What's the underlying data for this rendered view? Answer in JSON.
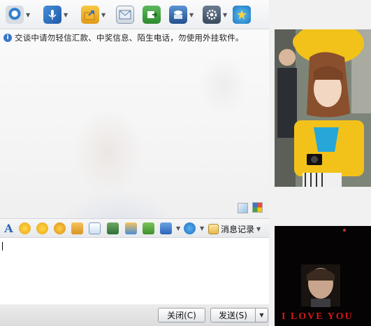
{
  "chat": {
    "warning_text": "交谈中请勿轻信汇款、中奖信息、陌生电话，勿使用外挂软件。"
  },
  "format_bar": {
    "font_icon_text": "A",
    "history_label": "消息记录"
  },
  "buttons": {
    "close_label": "关闭(C)",
    "send_label": "发送(S)"
  },
  "photo_bottom": {
    "banner_text": "I LOVE YOU"
  },
  "colors": {
    "toolbar_bg": "#eceff2",
    "accent_blue": "#3a76c6",
    "yellow_shirt": "#f2c21a",
    "dark_photo_bg": "#050303",
    "banner_red": "#d21a1a"
  },
  "icons": {
    "toolbar": [
      "webcam-icon",
      "microphone-icon",
      "send-file-icon",
      "email-icon",
      "share-icon",
      "app-store-icon",
      "settings-icon",
      "qzone-icon"
    ],
    "format": [
      "font-icon",
      "emoticon-icon",
      "magic-face-icon",
      "shake-icon",
      "like-icon",
      "pencil-icon",
      "screenshot-icon",
      "music-icon",
      "gift-icon",
      "screen-capture-icon",
      "soso-icon",
      "history-icon"
    ]
  }
}
